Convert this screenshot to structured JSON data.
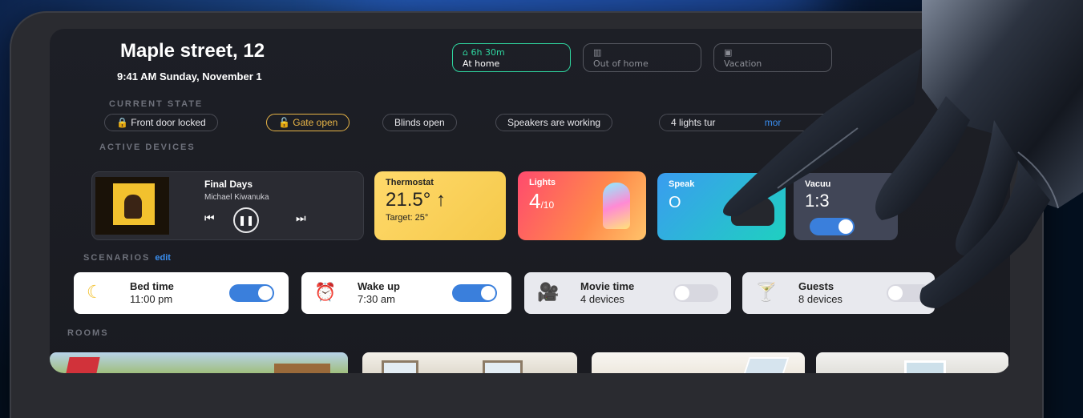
{
  "header": {
    "address": "Maple street, 12",
    "datetime": "9:41 AM Sunday, November 1"
  },
  "modes": [
    {
      "top": "6h 30m",
      "label": "At home",
      "icon": "home-icon"
    },
    {
      "top": "",
      "label": "Out of home",
      "icon": "building-icon"
    },
    {
      "top": "",
      "label": "Vacation",
      "icon": "suitcase-icon"
    }
  ],
  "current_state": {
    "label": "CURRENT STATE",
    "chips": [
      "Front door locked",
      "Gate open",
      "Blinds open",
      "Speakers are working",
      "4 lights tur"
    ],
    "more": "mor"
  },
  "active_devices": {
    "label": "ACTIVE DEVICES",
    "music": {
      "track": "Final Days",
      "artist": "Michael Kiwanuka"
    },
    "thermostat": {
      "label": "Thermostat",
      "value": "21.5°",
      "arrow": "↑",
      "target": "Target: 25°"
    },
    "lights": {
      "label": "Lights",
      "on": "4",
      "total": "/10"
    },
    "speakers": {
      "label": "Speak",
      "value": "O"
    },
    "vacuum": {
      "label": "Vacuu",
      "value": "1:3"
    }
  },
  "scenarios": {
    "label": "SCENARIOS",
    "edit": "edit",
    "items": [
      {
        "name": "Bed time",
        "detail": "11:00 pm",
        "icon": "moon-icon",
        "on": true
      },
      {
        "name": "Wake up",
        "detail": "7:30 am",
        "icon": "alarm-clock-icon",
        "on": true
      },
      {
        "name": "Movie time",
        "detail": "4 devices",
        "icon": "movie-camera-icon",
        "on": false
      },
      {
        "name": "Guests",
        "detail": "8 devices",
        "icon": "cocktail-icon",
        "on": false
      }
    ]
  },
  "rooms": {
    "label": "ROOMS"
  },
  "colors": {
    "accent_green": "#2fd6a0",
    "accent_blue": "#3a8ef0",
    "warning_yellow": "#e8b547"
  }
}
